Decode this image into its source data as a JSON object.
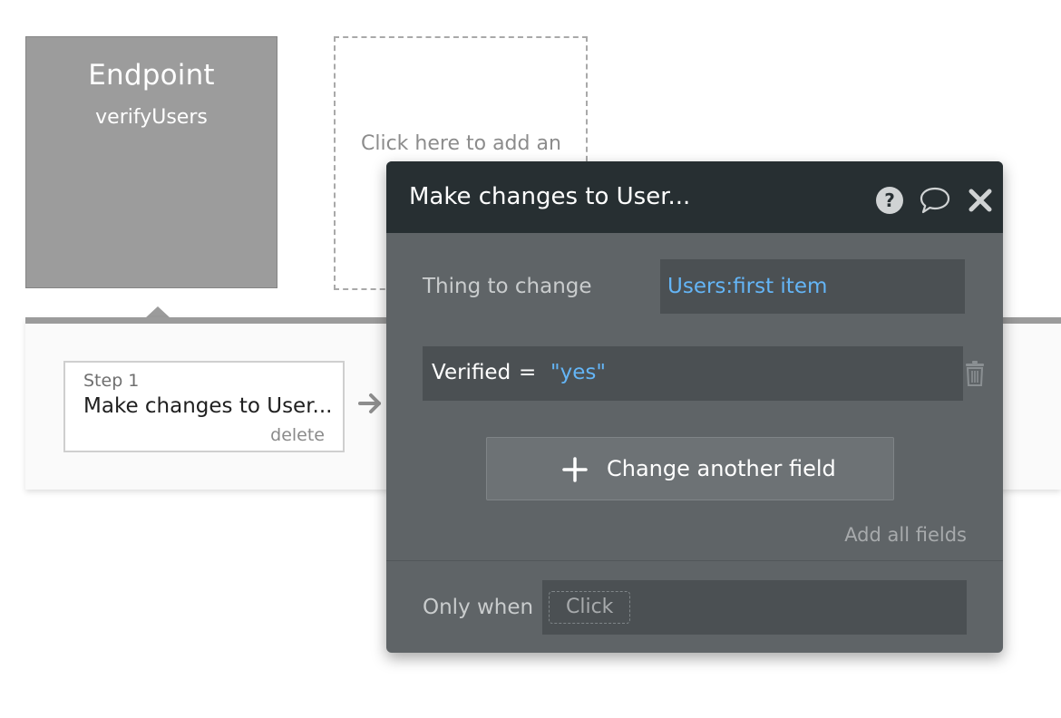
{
  "trigger": {
    "title": "Endpoint",
    "name": "verifyUsers"
  },
  "add_event": {
    "label": "Click here to add an"
  },
  "step": {
    "number_label": "Step 1",
    "name": "Make changes to User...",
    "delete_label": "delete"
  },
  "editor": {
    "title": "Make changes to User...",
    "icons": [
      "help-icon",
      "comment-icon",
      "close-icon"
    ],
    "thing_to_change": {
      "label": "Thing to change",
      "value": "Users:first item"
    },
    "fields": [
      {
        "name": "Verified",
        "operator": "=",
        "value": "\"yes\""
      }
    ],
    "change_another_label": "Change another field",
    "add_all_label": "Add all fields",
    "only_when": {
      "label": "Only when",
      "placeholder": "Click"
    }
  },
  "colors": {
    "header_bg": "#272f32",
    "panel_bg": "#5f6467",
    "input_bg": "#4b5053",
    "link_blue": "#64b5f6",
    "trigger_bg": "#9c9c9c"
  }
}
